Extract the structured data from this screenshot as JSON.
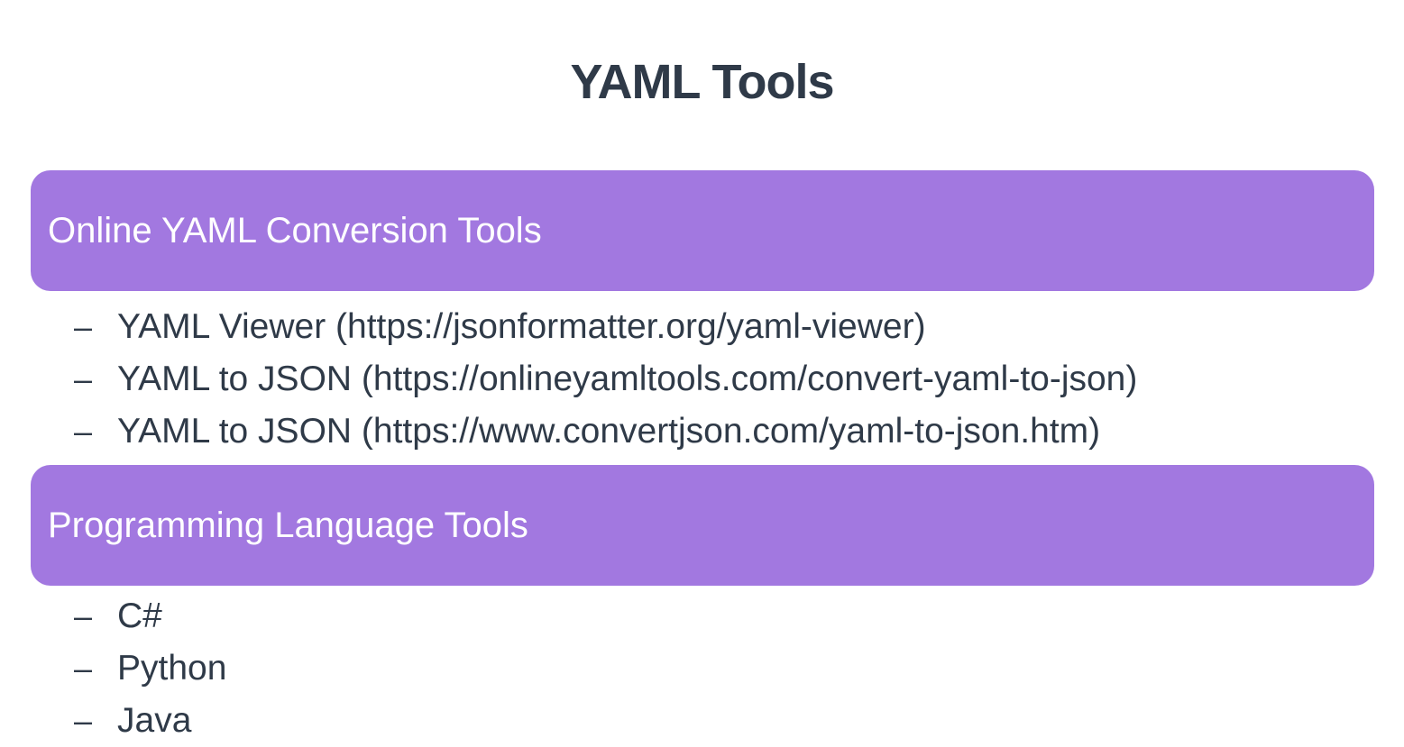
{
  "slide": {
    "title": "YAML Tools",
    "sections": [
      {
        "header": "Online YAML Conversion Tools",
        "items": [
          "YAML Viewer (https://jsonformatter.org/yaml-viewer)",
          "YAML to JSON (https://onlineyamltools.com/convert-yaml-to-json)",
          "YAML to JSON (https://www.convertjson.com/yaml-to-json.htm)"
        ]
      },
      {
        "header": "Programming Language Tools",
        "items": [
          "C#",
          "Python",
          "Java"
        ]
      }
    ],
    "bullet": "–"
  },
  "colors": {
    "title": "#2f3a48",
    "header_background": "#a278e0",
    "header_text": "#ffffff",
    "body_text": "#2f3a48"
  }
}
